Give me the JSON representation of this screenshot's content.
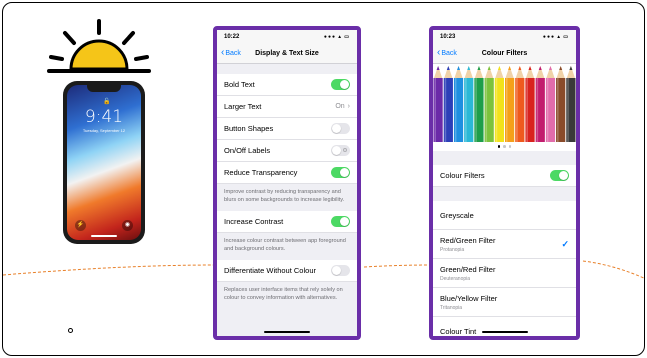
{
  "illustration": {
    "phone_time": "9:41",
    "phone_date": "Tuesday, September 12"
  },
  "display_screen": {
    "status_time": "10:22",
    "back_label": "Back",
    "title": "Display & Text Size",
    "rows": [
      {
        "label": "Bold Text",
        "toggle": "on"
      },
      {
        "label": "Larger Text",
        "value": "On"
      },
      {
        "label": "Button Shapes",
        "toggle": "off"
      },
      {
        "label": "On/Off Labels",
        "toggle": "off"
      },
      {
        "label": "Reduce Transparency",
        "toggle": "on"
      }
    ],
    "footer_transparency": "Improve contrast by reducing transparency and blurs on some backgrounds to increase legibility.",
    "increase_contrast": {
      "label": "Increase Contrast",
      "toggle": "on"
    },
    "footer_contrast": "Increase colour contrast between app foreground and background colours.",
    "differentiate": {
      "label": "Differentiate Without Colour",
      "toggle": "off"
    },
    "footer_differentiate": "Replaces user interface items that rely solely on colour to convey information with alternatives."
  },
  "filters_screen": {
    "status_time": "10:23",
    "back_label": "Back",
    "title": "Colour Filters",
    "pencil_colors": [
      "#6b2aa8",
      "#2c3fb8",
      "#1f8fe0",
      "#2bb8d6",
      "#1e9e4a",
      "#7cc23c",
      "#f2e21b",
      "#f5a01a",
      "#ef5a1e",
      "#d9231f",
      "#c21d6e",
      "#e26cab",
      "#8a4b2a",
      "#3a3a3a"
    ],
    "page_dots": 3,
    "colour_filters_label": "Colour Filters",
    "colour_filters_toggle": "on",
    "options": [
      {
        "label": "Greyscale",
        "sub": ""
      },
      {
        "label": "Red/Green Filter",
        "sub": "Protanopia",
        "selected": true
      },
      {
        "label": "Green/Red Filter",
        "sub": "Deuteranopia"
      },
      {
        "label": "Blue/Yellow Filter",
        "sub": "Tritanopia"
      },
      {
        "label": "Colour Tint",
        "sub": ""
      }
    ]
  },
  "colors": {
    "accent_purple": "#6a2ea8",
    "ios_blue": "#007aff",
    "ios_green": "#4cd964",
    "sun_yellow": "#f5c518",
    "dashed_line": "#e8802a"
  }
}
